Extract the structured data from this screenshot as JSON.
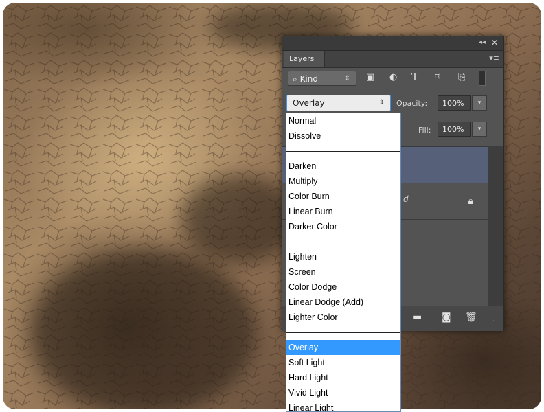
{
  "panel": {
    "tab_label": "Layers",
    "collapse_icon": "◂◂",
    "close_icon": "✕",
    "menu_icon": "▾≡",
    "filter": {
      "kind_label": "Kind",
      "kind_icon": "⌕",
      "arrow": "⇕"
    },
    "blend": {
      "value": "Overlay",
      "arrow": "⇕"
    },
    "opacity": {
      "label": "Opacity:",
      "value": "100%"
    },
    "fill": {
      "label": "Fill:",
      "value": "100%"
    },
    "layer_partial_text": "d"
  },
  "dropdown": {
    "groups": [
      [
        "Normal",
        "Dissolve"
      ],
      [
        "Darken",
        "Multiply",
        "Color Burn",
        "Linear Burn",
        "Darker Color"
      ],
      [
        "Lighten",
        "Screen",
        "Color Dodge",
        "Linear Dodge (Add)",
        "Lighter Color"
      ],
      [
        "Overlay",
        "Soft Light",
        "Hard Light",
        "Vivid Light",
        "Linear Light"
      ]
    ],
    "selected": "Overlay"
  },
  "colors": {
    "selection": "#3399ff",
    "panel": "#535353",
    "selected_layer": "#576079"
  }
}
